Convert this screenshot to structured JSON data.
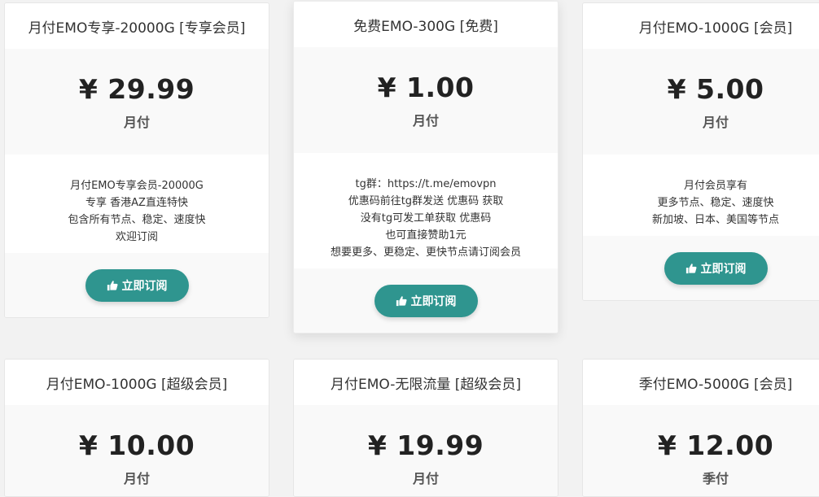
{
  "subscribe_label": "立即订阅",
  "plans": [
    {
      "title": "月付EMO专享-20000G [专享会员]",
      "price": "¥ 29.99",
      "period": "月付",
      "description": [
        "月付EMO专享会员-20000G",
        "专享 香港AZ直连特快",
        "包含所有节点、稳定、速度快",
        "欢迎订阅"
      ]
    },
    {
      "title": "免费EMO-300G [免费]",
      "price": "¥ 1.00",
      "period": "月付",
      "description": [
        "tg群：https://t.me/emovpn",
        "优惠码前往tg群发送 优惠码 获取",
        "没有tg可发工单获取 优惠码",
        "也可直接赞助1元",
        "想要更多、更稳定、更快节点请订阅会员"
      ]
    },
    {
      "title": "月付EMO-1000G [会员]",
      "price": "¥ 5.00",
      "period": "月付",
      "description": [
        "月付会员享有",
        "更多节点、稳定、速度快",
        "新加坡、日本、美国等节点"
      ]
    },
    {
      "title": "月付EMO-1000G [超级会员]",
      "price": "¥ 10.00",
      "period": "月付"
    },
    {
      "title": "月付EMO-无限流量 [超级会员]",
      "price": "¥ 19.99",
      "period": "月付"
    },
    {
      "title": "季付EMO-5000G [会员]",
      "price": "¥ 12.00",
      "period": "季付"
    }
  ],
  "colors": {
    "button": "#2f958f",
    "page_bg": "#f2f2f2",
    "price_bg": "#f9f9f9"
  },
  "icons": {
    "button_icon": "thumbs-up-icon"
  }
}
